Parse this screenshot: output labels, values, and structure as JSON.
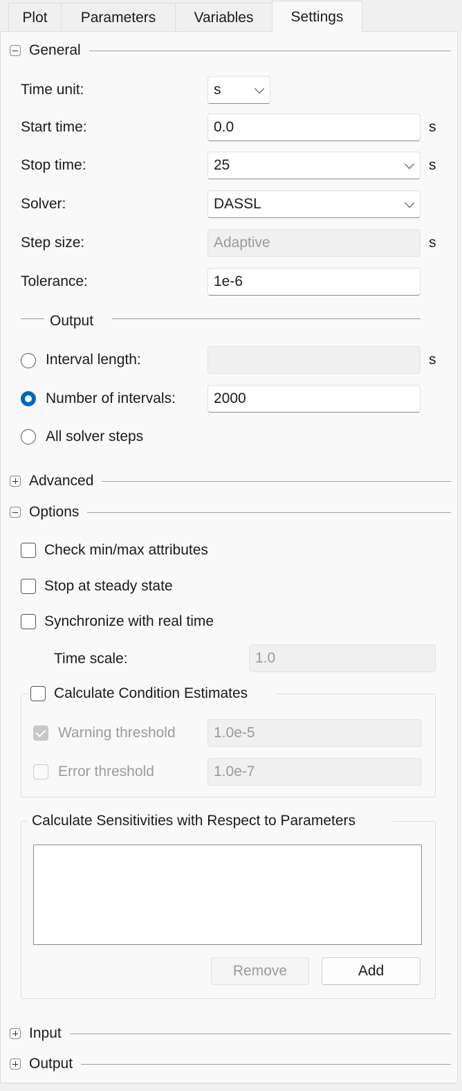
{
  "tabs": [
    {
      "label": "Plot"
    },
    {
      "label": "Parameters"
    },
    {
      "label": "Variables"
    },
    {
      "label": "Settings",
      "active": true
    }
  ],
  "general": {
    "title": "General",
    "expanded": true,
    "time_unit": {
      "label": "Time unit:",
      "value": "s"
    },
    "start_time": {
      "label": "Start time:",
      "value": "0.0",
      "unit": "s"
    },
    "stop_time": {
      "label": "Stop time:",
      "value": "25",
      "unit": "s"
    },
    "solver": {
      "label": "Solver:",
      "value": "DASSL"
    },
    "step_size": {
      "label": "Step size:",
      "placeholder": "Adaptive",
      "unit": "s"
    },
    "tolerance": {
      "label": "Tolerance:",
      "value": "1e-6"
    },
    "output": {
      "title": "Output",
      "interval_length": {
        "label": "Interval length:",
        "value": "",
        "unit": "s",
        "selected": false
      },
      "number_of_intervals": {
        "label": "Number of intervals:",
        "value": "2000",
        "selected": true
      },
      "all_solver_steps": {
        "label": "All solver steps",
        "selected": false
      }
    }
  },
  "advanced": {
    "title": "Advanced",
    "expanded": false
  },
  "options": {
    "title": "Options",
    "expanded": true,
    "check_minmax": {
      "label": "Check min/max attributes",
      "checked": false
    },
    "stop_steady": {
      "label": "Stop at steady state",
      "checked": false
    },
    "sync_realtime": {
      "label": "Synchronize with real time",
      "checked": false
    },
    "time_scale": {
      "label": "Time scale:",
      "placeholder": "1.0"
    },
    "condition": {
      "label": "Calculate Condition Estimates",
      "checked": false,
      "warning": {
        "label": "Warning threshold",
        "value": "1.0e-5",
        "checked": true
      },
      "error": {
        "label": "Error threshold",
        "value": "1.0e-7",
        "checked": false
      }
    },
    "sensitivities": {
      "title": "Calculate Sensitivities with Respect to Parameters",
      "items": [],
      "remove_label": "Remove",
      "add_label": "Add"
    }
  },
  "input": {
    "title": "Input",
    "expanded": false
  },
  "output_section": {
    "title": "Output",
    "expanded": false
  },
  "colors": {
    "accent": "#0067c0"
  }
}
